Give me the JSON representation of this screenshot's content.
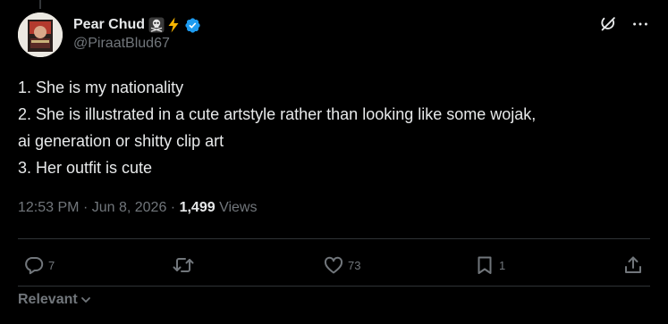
{
  "author": {
    "display_name": "Pear Chud",
    "handle": "@PiraatBlud67",
    "name_emoji": [
      "skull-crossbones-emoji",
      "lightning-emoji"
    ],
    "verified": true
  },
  "tweet": {
    "lines": [
      "1. She is my nationality",
      "2. She is illustrated in a cute artstyle rather than looking like some wojak,",
      "ai generation or shitty clip art",
      "3. Her outfit is cute"
    ],
    "time": "12:53 PM",
    "date": "Jun 8, 2026",
    "views_count": "1,499",
    "views_label": "Views"
  },
  "actions": {
    "replies": "7",
    "reposts": "",
    "likes": "73",
    "bookmarks": "1"
  },
  "sort": {
    "label": "Relevant"
  },
  "colors": {
    "background": "#000000",
    "text": "#e7e9ea",
    "secondary": "#71767b",
    "divider": "#2f3336",
    "verified": "#1d9bf0",
    "lightning": "#f7b500"
  },
  "icons": {
    "header": [
      "grok-icon",
      "more-icon"
    ],
    "actions": [
      "reply-icon",
      "repost-icon",
      "like-icon",
      "bookmark-icon",
      "share-icon"
    ],
    "sort": "chevron-down-icon"
  }
}
